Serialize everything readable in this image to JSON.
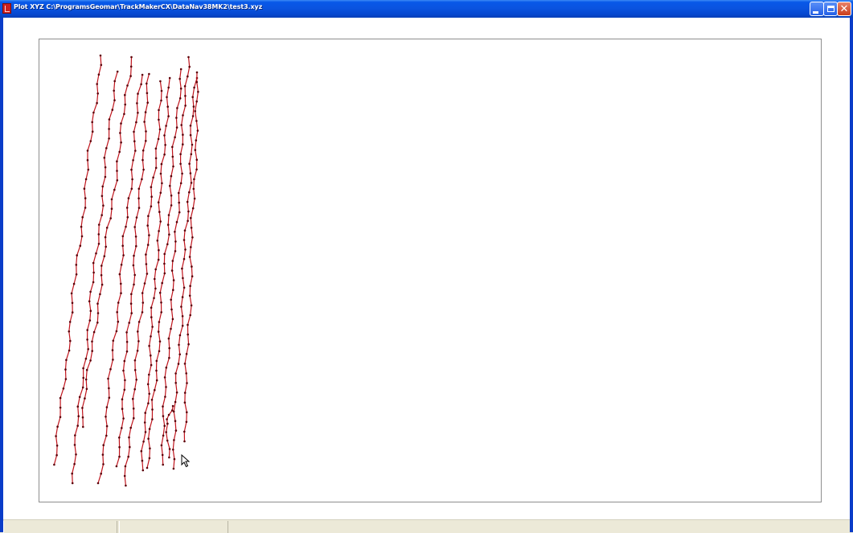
{
  "window": {
    "title": "Plot XYZ  C:\\ProgramsGeomar\\TrackMakerCX\\DataNav38MK2\\test3.xyz",
    "controls": {
      "minimize": "minimize",
      "maximize": "maximize",
      "close": "✕"
    }
  },
  "plot": {
    "track_color": "#c0141c",
    "point_color": "#5a0008",
    "background": "#ffffff",
    "frame_color": "#8e8e8e"
  },
  "statusbar": {
    "panes": [
      "",
      ""
    ]
  },
  "icons": [
    "app-icon",
    "minimize-icon",
    "maximize-icon",
    "close-icon",
    "mouse-pointer-icon"
  ]
}
